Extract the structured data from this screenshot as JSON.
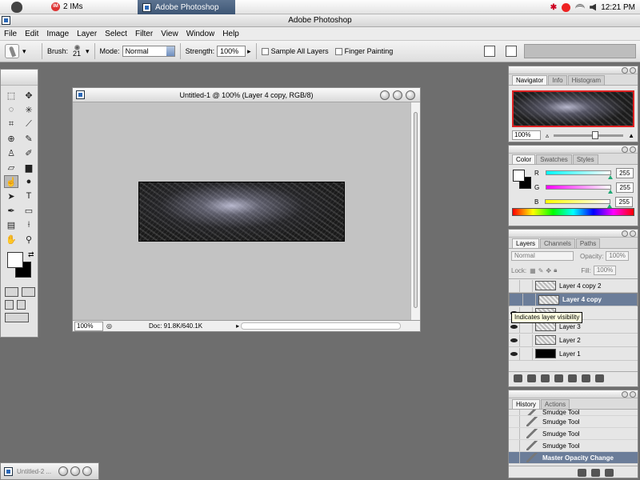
{
  "system_bar": {
    "im_label": "2 IMs",
    "im_badge": "IM",
    "taskbar_app": "Adobe Photoshop",
    "clock": "12:21 PM"
  },
  "app": {
    "title": "Adobe Photoshop"
  },
  "menu": [
    "File",
    "Edit",
    "Image",
    "Layer",
    "Select",
    "Filter",
    "View",
    "Window",
    "Help"
  ],
  "options": {
    "brush_label": "Brush:",
    "brush_size": "21",
    "mode_label": "Mode:",
    "mode_value": "Normal",
    "strength_label": "Strength:",
    "strength_value": "100%",
    "sample_all": "Sample All Layers",
    "finger_painting": "Finger Painting"
  },
  "document": {
    "title": "Untitled-1 @ 100% (Layer 4 copy, RGB/8)",
    "zoom": "100%",
    "doc_info": "Doc: 91.8K/640.1K"
  },
  "navigator": {
    "tabs": [
      "Navigator",
      "Info",
      "Histogram"
    ],
    "zoom": "100%"
  },
  "color_panel": {
    "tabs": [
      "Color",
      "Swatches",
      "Styles"
    ],
    "channels": [
      {
        "label": "R",
        "value": "255",
        "gradient": "#00ffff"
      },
      {
        "label": "G",
        "value": "255",
        "gradient": "#ff00ff"
      },
      {
        "label": "B",
        "value": "255",
        "gradient": "#ffff00"
      }
    ]
  },
  "layers_panel": {
    "tabs": [
      "Layers",
      "Channels",
      "Paths"
    ],
    "blend_mode": "Normal",
    "opacity_label": "Opacity:",
    "opacity_value": "100%",
    "lock_label": "Lock:",
    "fill_label": "Fill:",
    "fill_value": "100%",
    "layers": [
      "Layer 4 copy 2",
      "Layer 4 copy",
      "",
      "Layer 3",
      "Layer 2",
      "Layer 1"
    ],
    "tooltip": "Indicates layer visibility"
  },
  "history_panel": {
    "tabs": [
      "History",
      "Actions"
    ],
    "items": [
      "Smudge Tool",
      "Smudge Tool",
      "Smudge Tool",
      "Smudge Tool",
      "Master Opacity Change"
    ]
  },
  "minimized": {
    "title": "Untitled-2 ..."
  }
}
